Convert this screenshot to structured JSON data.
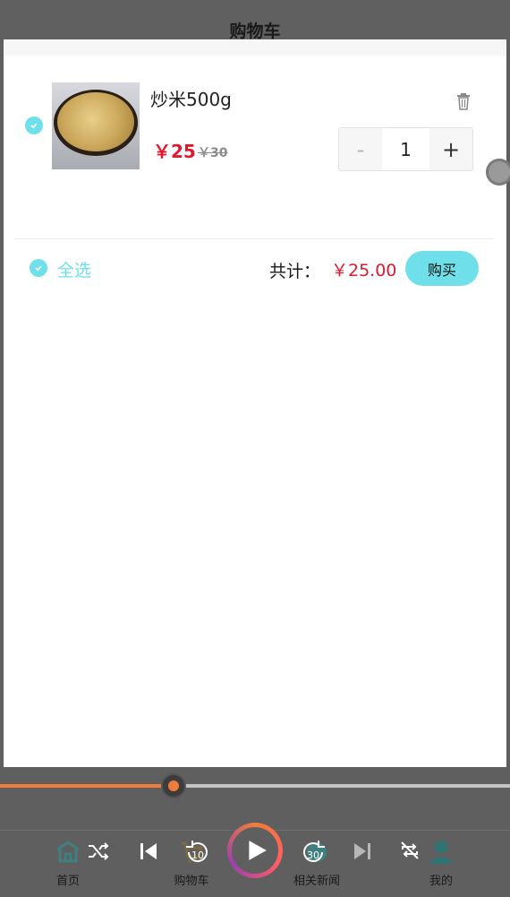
{
  "header": {
    "title": "购物车"
  },
  "cart": {
    "items": [
      {
        "name": "炒米500g",
        "price": "￥25",
        "old_price": "￥30",
        "quantity": "1",
        "checked": true
      }
    ],
    "stepper": {
      "minus": "-",
      "plus": "+"
    }
  },
  "footer": {
    "select_all": "全选",
    "total_label": "共计：",
    "total_amount": "￥25.00",
    "buy": "购买"
  },
  "player": {
    "progress": 0.34,
    "accent": "#f07c3a",
    "rewind_seconds": "10",
    "forward_seconds": "30"
  },
  "tabbar": {
    "items": [
      {
        "label": "首页",
        "icon": "home-icon"
      },
      {
        "label": "购物车",
        "icon": "cart-icon"
      },
      {
        "label": "相关新闻",
        "icon": "news-icon"
      },
      {
        "label": "我的",
        "icon": "user-icon"
      }
    ]
  },
  "colors": {
    "accent_cyan": "#6fe0ea",
    "price_red": "#e0182c"
  }
}
